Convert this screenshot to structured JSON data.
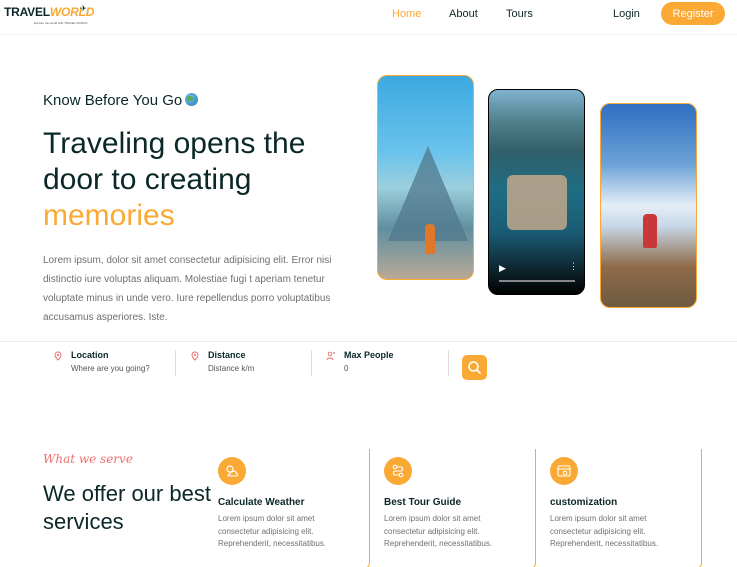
{
  "header": {
    "logo": {
      "travel": "TRAVEL",
      "world": "WORLD",
      "tagline": "Explore the world with TRAVEL WORLD"
    },
    "nav": [
      {
        "label": "Home",
        "active": true
      },
      {
        "label": "About",
        "active": false
      },
      {
        "label": "Tours",
        "active": false
      }
    ],
    "login_label": "Login",
    "register_label": "Register"
  },
  "hero": {
    "subtitle": "Know Before You Go",
    "headline_line1": "Traveling opens the",
    "headline_line2": "door to creating",
    "headline_highlight": "memories",
    "description": "Lorem ipsum, dolor sit amet consectetur adipisicing elit. Error nisi distinctio iure voluptas aliquam. Molestiae fugi t aperiam tenetur voluptate minus in unde vero. Iure repellendus porro voluptatibus accusamus asperiores. Iste."
  },
  "search": {
    "location": {
      "label": "Location",
      "value": "Where are you going?"
    },
    "distance": {
      "label": "Distance",
      "value": "Distance k/m"
    },
    "max_people": {
      "label": "Max People",
      "value": "0"
    }
  },
  "services": {
    "subtitle": "What we serve",
    "title": "We offer our best services",
    "cards": [
      {
        "title": "Calculate Weather",
        "description": "Lorem ipsum dolor sit amet consectetur adipisicing elit. Reprehenderit, necessitatibus.",
        "icon": "weather-icon"
      },
      {
        "title": "Best Tour Guide",
        "description": "Lorem ipsum dolor sit amet consectetur adipisicing elit. Reprehenderit, necessitatibus.",
        "icon": "guide-icon"
      },
      {
        "title": "customization",
        "description": "Lorem ipsum dolor sit amet consectetur adipisicing elit. Reprehenderit, necessitatibus.",
        "icon": "customization-icon"
      }
    ]
  },
  "colors": {
    "accent": "#faa935",
    "heading": "#0b2727",
    "text": "#6e7074",
    "script": "#ee6e6e"
  }
}
